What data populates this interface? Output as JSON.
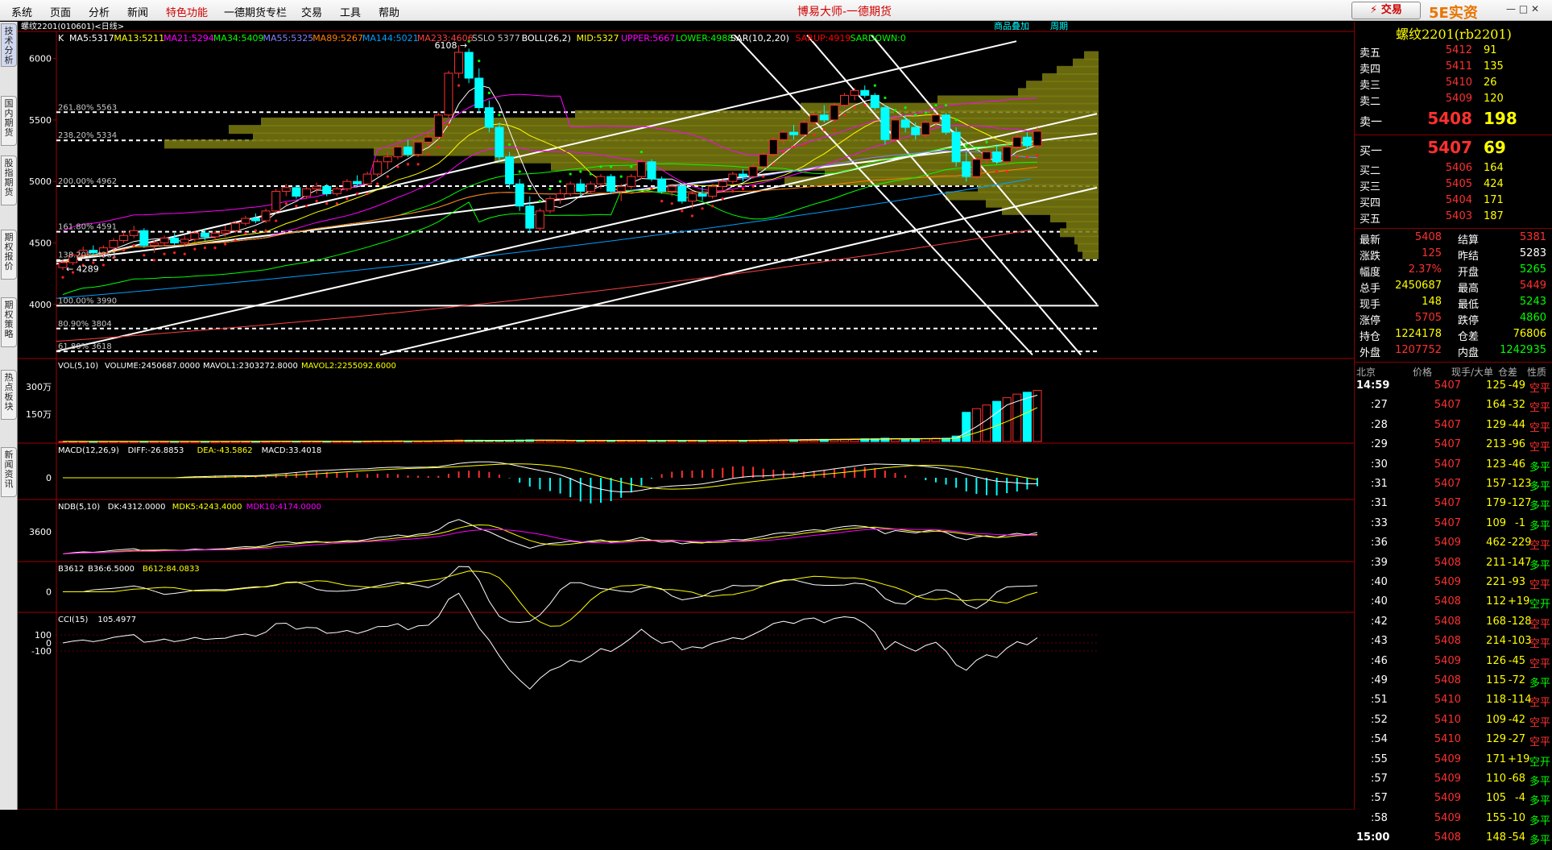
{
  "menu": [
    "系统",
    "页面",
    "分析",
    "新闻",
    "特色功能",
    "一德期货专栏",
    "交易",
    "工具",
    "帮助"
  ],
  "app_title": "博易大师-一德期货",
  "trade_button": "⚡ 交易",
  "watermark": "5E实资5etz.com",
  "window_controls": "— □ ✕",
  "side_tabs": [
    "技术分析",
    "国内期货",
    "股指期货",
    "期权报价",
    "期权策略",
    "热点板块",
    "新闻资讯"
  ],
  "chart": {
    "symbol_title": "螺纹2201(010601)<日线>",
    "top_buttons": [
      "商品叠加",
      "周期"
    ],
    "main_label": "K",
    "main_indicators": [
      {
        "text": "MA5:5317",
        "color": "#ffffff"
      },
      {
        "text": "MA13:5211",
        "color": "#ffff00"
      },
      {
        "text": "MA21:5294",
        "color": "#ff00ff"
      },
      {
        "text": "MA34:5409",
        "color": "#00ff00"
      },
      {
        "text": "MA55:5325",
        "color": "#8080ff"
      },
      {
        "text": "MA89:5267",
        "color": "#ff8000"
      },
      {
        "text": "MA144:5021",
        "color": "#00a0ff"
      },
      {
        "text": "MA233:4606",
        "color": "#ff4040"
      },
      {
        "text": "SSLO 5377",
        "color": "#c0c0c0"
      },
      {
        "text": "BOLL(26,2)",
        "color": "#ffffff"
      },
      {
        "text": "MID:5327",
        "color": "#ffff00"
      },
      {
        "text": "UPPER:5667",
        "color": "#ff00ff"
      },
      {
        "text": "LOWER:4988",
        "color": "#00ff00"
      },
      {
        "text": "SAR(10,2,20)",
        "color": "#ffffff"
      },
      {
        "text": "SARUP:4919",
        "color": "#ff0000"
      },
      {
        "text": "SARDOWN:0",
        "color": "#00ff00"
      }
    ],
    "price_ticks": [
      6000,
      5500,
      5000,
      4500,
      4000
    ],
    "fib_levels": [
      {
        "label": "261.80% 5563",
        "price": 5563
      },
      {
        "label": "238.20% 5334",
        "price": 5334
      },
      {
        "label": "200.00% 4962",
        "price": 4962
      },
      {
        "label": "161.80% 4591",
        "price": 4591
      },
      {
        "label": "138.20% 4361",
        "price": 4361
      },
      {
        "label": "100.00% 3990",
        "price": 3990
      },
      {
        "label": "80.90% 3804",
        "price": 3804
      },
      {
        "label": "61.80% 3618",
        "price": 3618
      }
    ],
    "annotations": {
      "high": "6108",
      "low": "4289"
    },
    "vol_label": "VOL(5,10)",
    "vol_indicators": [
      {
        "text": "VOLUME:2450687.0000",
        "color": "#ffffff"
      },
      {
        "text": "MAVOL1:2303272.8000",
        "color": "#ffffff"
      },
      {
        "text": "MAVOL2:2255092.6000",
        "color": "#ffff00"
      }
    ],
    "vol_ticks": [
      "300万",
      "150万"
    ],
    "macd_label": "MACD(12,26,9)",
    "macd_indicators": [
      {
        "text": "DIFF:-26.8853",
        "color": "#ffffff"
      },
      {
        "text": "DEA:-43.5862",
        "color": "#ffff00"
      },
      {
        "text": "MACD:33.4018",
        "color": "#ffffff"
      }
    ],
    "macd_ticks": [
      "0"
    ],
    "ndb_label": "NDB(5,10)",
    "ndb_indicators": [
      {
        "text": "DK:4312.0000",
        "color": "#ffffff"
      },
      {
        "text": "MDK5:4243.4000",
        "color": "#ffff00"
      },
      {
        "text": "MDK10:4174.0000",
        "color": "#ff00ff"
      }
    ],
    "ndb_ticks": [
      "3600"
    ],
    "b3612_label": "B3612",
    "b3612_indicators": [
      {
        "text": "B36:6.5000",
        "color": "#ffffff"
      },
      {
        "text": "B612:84.0833",
        "color": "#ffff00"
      }
    ],
    "b3612_ticks": [
      "0"
    ],
    "cci_label": "CCI(15)",
    "cci_indicators": [
      {
        "text": "105.4977",
        "color": "#ffffff"
      }
    ],
    "cci_ticks": [
      "100",
      "0",
      "-100"
    ]
  },
  "quote": {
    "title": "螺纹2201(rb2201)",
    "asks": [
      {
        "label": "卖五",
        "price": "5412",
        "vol": "91"
      },
      {
        "label": "卖四",
        "price": "5411",
        "vol": "135"
      },
      {
        "label": "卖三",
        "price": "5410",
        "vol": "26"
      },
      {
        "label": "卖二",
        "price": "5409",
        "vol": "120"
      },
      {
        "label": "卖一",
        "price": "5408",
        "vol": "198"
      }
    ],
    "bids": [
      {
        "label": "买一",
        "price": "5407",
        "vol": "69"
      },
      {
        "label": "买二",
        "price": "5406",
        "vol": "164"
      },
      {
        "label": "买三",
        "price": "5405",
        "vol": "424"
      },
      {
        "label": "买四",
        "price": "5404",
        "vol": "171"
      },
      {
        "label": "买五",
        "price": "5403",
        "vol": "187"
      }
    ],
    "stats": [
      {
        "l1": "最新",
        "v1": "5408",
        "c1": "red",
        "l2": "结算",
        "v2": "5381",
        "c2": "red"
      },
      {
        "l1": "涨跌",
        "v1": "125",
        "c1": "red",
        "l2": "昨结",
        "v2": "5283",
        "c2": "white"
      },
      {
        "l1": "幅度",
        "v1": "2.37%",
        "c1": "red",
        "l2": "开盘",
        "v2": "5265",
        "c2": "green"
      },
      {
        "l1": "总手",
        "v1": "2450687",
        "c1": "yellow",
        "l2": "最高",
        "v2": "5449",
        "c2": "red"
      },
      {
        "l1": "现手",
        "v1": "148",
        "c1": "yellow",
        "l2": "最低",
        "v2": "5243",
        "c2": "green"
      },
      {
        "l1": "涨停",
        "v1": "5705",
        "c1": "red",
        "l2": "跌停",
        "v2": "4860",
        "c2": "green"
      },
      {
        "l1": "持仓",
        "v1": "1224178",
        "c1": "yellow",
        "l2": "仓差",
        "v2": "76806",
        "c2": "yellow"
      },
      {
        "l1": "外盘",
        "v1": "1207752",
        "c1": "red",
        "l2": "内盘",
        "v2": "1242935",
        "c2": "green"
      }
    ],
    "ts_headers": [
      "北京",
      "价格",
      "现手/大单",
      "仓差",
      "性质"
    ],
    "ticks": [
      {
        "t": "14:59",
        "p": "5407",
        "v": "125",
        "c": "-49",
        "n": "空平",
        "nc": "red"
      },
      {
        "t": ":27",
        "p": "5407",
        "v": "164",
        "c": "-32",
        "n": "空平",
        "nc": "red"
      },
      {
        "t": ":28",
        "p": "5407",
        "v": "129",
        "c": "-44",
        "n": "空平",
        "nc": "red"
      },
      {
        "t": ":29",
        "p": "5407",
        "v": "213",
        "c": "-96",
        "n": "空平",
        "nc": "red"
      },
      {
        "t": ":30",
        "p": "5407",
        "v": "123",
        "c": "-46",
        "n": "多平",
        "nc": "green"
      },
      {
        "t": ":31",
        "p": "5407",
        "v": "157",
        "c": "-123",
        "n": "多平",
        "nc": "green"
      },
      {
        "t": ":31",
        "p": "5407",
        "v": "179",
        "c": "-127",
        "n": "多平",
        "nc": "green"
      },
      {
        "t": ":33",
        "p": "5407",
        "v": "109",
        "c": "-1",
        "n": "多平",
        "nc": "green"
      },
      {
        "t": ":36",
        "p": "5409",
        "v": "462",
        "c": "-229",
        "n": "空平",
        "nc": "red"
      },
      {
        "t": ":39",
        "p": "5408",
        "v": "211",
        "c": "-147",
        "n": "多平",
        "nc": "green"
      },
      {
        "t": ":40",
        "p": "5409",
        "v": "221",
        "c": "-93",
        "n": "空平",
        "nc": "red"
      },
      {
        "t": ":40",
        "p": "5408",
        "v": "112",
        "c": "+19",
        "n": "空开",
        "nc": "green"
      },
      {
        "t": ":42",
        "p": "5408",
        "v": "168",
        "c": "-128",
        "n": "空平",
        "nc": "red"
      },
      {
        "t": ":43",
        "p": "5408",
        "v": "214",
        "c": "-103",
        "n": "空平",
        "nc": "red"
      },
      {
        "t": ":46",
        "p": "5409",
        "v": "126",
        "c": "-45",
        "n": "空平",
        "nc": "red"
      },
      {
        "t": ":49",
        "p": "5408",
        "v": "115",
        "c": "-72",
        "n": "多平",
        "nc": "green"
      },
      {
        "t": ":51",
        "p": "5410",
        "v": "118",
        "c": "-114",
        "n": "空平",
        "nc": "red"
      },
      {
        "t": ":52",
        "p": "5410",
        "v": "109",
        "c": "-42",
        "n": "空平",
        "nc": "red"
      },
      {
        "t": ":54",
        "p": "5410",
        "v": "129",
        "c": "-27",
        "n": "空平",
        "nc": "red"
      },
      {
        "t": ":55",
        "p": "5409",
        "v": "171",
        "c": "+19",
        "n": "空开",
        "nc": "green"
      },
      {
        "t": ":57",
        "p": "5409",
        "v": "110",
        "c": "-68",
        "n": "多平",
        "nc": "green"
      },
      {
        "t": ":57",
        "p": "5409",
        "v": "105",
        "c": "-4",
        "n": "多平",
        "nc": "green"
      },
      {
        "t": ":58",
        "p": "5409",
        "v": "155",
        "c": "-10",
        "n": "多平",
        "nc": "green"
      },
      {
        "t": "15:00",
        "p": "5408",
        "v": "148",
        "c": "-54",
        "n": "多平",
        "nc": "green"
      }
    ]
  },
  "chart_data": {
    "type": "candlestick",
    "title": "螺纹2201(010601)<日线>",
    "ylim": [
      3560,
      6220
    ],
    "ohlc": [
      [
        4300,
        4360,
        4280,
        4340
      ],
      [
        4340,
        4420,
        4320,
        4400
      ],
      [
        4400,
        4470,
        4380,
        4440
      ],
      [
        4440,
        4480,
        4400,
        4420
      ],
      [
        4420,
        4480,
        4380,
        4460
      ],
      [
        4460,
        4540,
        4440,
        4520
      ],
      [
        4520,
        4600,
        4500,
        4560
      ],
      [
        4560,
        4640,
        4540,
        4600
      ],
      [
        4600,
        4620,
        4460,
        4480
      ],
      [
        4480,
        4520,
        4420,
        4500
      ],
      [
        4500,
        4560,
        4470,
        4540
      ],
      [
        4540,
        4580,
        4480,
        4500
      ],
      [
        4500,
        4560,
        4470,
        4530
      ],
      [
        4530,
        4600,
        4510,
        4580
      ],
      [
        4580,
        4620,
        4520,
        4550
      ],
      [
        4550,
        4600,
        4520,
        4580
      ],
      [
        4580,
        4640,
        4550,
        4600
      ],
      [
        4600,
        4680,
        4580,
        4660
      ],
      [
        4660,
        4720,
        4640,
        4700
      ],
      [
        4700,
        4740,
        4660,
        4680
      ],
      [
        4680,
        4780,
        4660,
        4760
      ],
      [
        4760,
        4940,
        4740,
        4920
      ],
      [
        4920,
        4980,
        4880,
        4950
      ],
      [
        4950,
        4970,
        4860,
        4880
      ],
      [
        4880,
        4960,
        4860,
        4940
      ],
      [
        4940,
        4990,
        4900,
        4960
      ],
      [
        4960,
        4980,
        4880,
        4900
      ],
      [
        4900,
        4960,
        4880,
        4940
      ],
      [
        4940,
        5020,
        4920,
        5000
      ],
      [
        5000,
        5050,
        4960,
        4980
      ],
      [
        4980,
        5080,
        4960,
        5060
      ],
      [
        5060,
        5180,
        5040,
        5160
      ],
      [
        5160,
        5240,
        5100,
        5200
      ],
      [
        5200,
        5300,
        5180,
        5280
      ],
      [
        5280,
        5340,
        5200,
        5220
      ],
      [
        5220,
        5340,
        5200,
        5320
      ],
      [
        5320,
        5400,
        5280,
        5360
      ],
      [
        5360,
        5560,
        5340,
        5540
      ],
      [
        5540,
        5900,
        5520,
        5880
      ],
      [
        5880,
        6108,
        5840,
        6050
      ],
      [
        6050,
        6080,
        5800,
        5840
      ],
      [
        5840,
        5920,
        5560,
        5600
      ],
      [
        5600,
        5660,
        5400,
        5440
      ],
      [
        5440,
        5480,
        5160,
        5200
      ],
      [
        5200,
        5240,
        4940,
        4980
      ],
      [
        4980,
        5020,
        4760,
        4800
      ],
      [
        4800,
        4880,
        4580,
        4620
      ],
      [
        4620,
        4780,
        4600,
        4760
      ],
      [
        4760,
        4880,
        4740,
        4860
      ],
      [
        4860,
        4940,
        4820,
        4900
      ],
      [
        4900,
        5000,
        4880,
        4980
      ],
      [
        4980,
        5020,
        4880,
        4920
      ],
      [
        4920,
        5000,
        4900,
        4980
      ],
      [
        4980,
        5060,
        4940,
        5040
      ],
      [
        5040,
        5060,
        4900,
        4920
      ],
      [
        4920,
        4980,
        4840,
        4960
      ],
      [
        4960,
        5060,
        4940,
        5040
      ],
      [
        5040,
        5180,
        5020,
        5160
      ],
      [
        5160,
        5180,
        5000,
        5020
      ],
      [
        5020,
        5040,
        4900,
        4920
      ],
      [
        4920,
        4980,
        4880,
        4960
      ],
      [
        4960,
        4980,
        4820,
        4840
      ],
      [
        4840,
        4920,
        4780,
        4900
      ],
      [
        4900,
        4960,
        4840,
        4880
      ],
      [
        4880,
        4980,
        4860,
        4960
      ],
      [
        4960,
        5020,
        4920,
        5000
      ],
      [
        5000,
        5080,
        4980,
        5060
      ],
      [
        5060,
        5100,
        5000,
        5040
      ],
      [
        5040,
        5140,
        5020,
        5120
      ],
      [
        5120,
        5240,
        5100,
        5220
      ],
      [
        5220,
        5360,
        5200,
        5340
      ],
      [
        5340,
        5420,
        5300,
        5400
      ],
      [
        5400,
        5460,
        5340,
        5380
      ],
      [
        5380,
        5500,
        5360,
        5480
      ],
      [
        5480,
        5560,
        5440,
        5540
      ],
      [
        5540,
        5620,
        5480,
        5500
      ],
      [
        5500,
        5640,
        5480,
        5620
      ],
      [
        5620,
        5720,
        5600,
        5700
      ],
      [
        5700,
        5760,
        5660,
        5740
      ],
      [
        5740,
        5780,
        5680,
        5700
      ],
      [
        5700,
        5720,
        5580,
        5600
      ],
      [
        5600,
        5620,
        5300,
        5340
      ],
      [
        5340,
        5520,
        5320,
        5500
      ],
      [
        5500,
        5540,
        5400,
        5440
      ],
      [
        5440,
        5480,
        5340,
        5380
      ],
      [
        5380,
        5500,
        5360,
        5480
      ],
      [
        5480,
        5560,
        5440,
        5540
      ],
      [
        5540,
        5560,
        5380,
        5400
      ],
      [
        5400,
        5440,
        5120,
        5160
      ],
      [
        5160,
        5240,
        5000,
        5040
      ],
      [
        5040,
        5200,
        5020,
        5180
      ],
      [
        5180,
        5260,
        5140,
        5240
      ],
      [
        5240,
        5300,
        5140,
        5160
      ],
      [
        5160,
        5300,
        5140,
        5280
      ],
      [
        5280,
        5380,
        5260,
        5360
      ],
      [
        5360,
        5400,
        5260,
        5290
      ],
      [
        5290,
        5440,
        5270,
        5408
      ]
    ],
    "volume_wan": [
      0.3,
      0.4,
      0.4,
      0.3,
      0.4,
      0.5,
      0.5,
      0.6,
      0.7,
      0.5,
      0.5,
      0.5,
      0.6,
      0.6,
      0.6,
      0.5,
      0.7,
      0.8,
      0.8,
      0.7,
      1,
      2,
      2,
      1.6,
      1.5,
      1.4,
      1.3,
      1.3,
      1.6,
      1.4,
      2,
      3,
      3,
      3,
      2,
      2,
      2.5,
      4,
      6,
      8,
      7,
      7,
      6,
      6,
      7,
      8,
      9,
      7,
      6,
      6,
      5,
      5,
      5,
      6,
      6,
      5,
      5,
      6,
      6,
      5,
      5,
      5,
      5,
      5,
      5,
      6,
      6,
      6,
      7,
      8,
      9,
      10,
      10,
      11,
      12,
      12,
      12,
      13,
      14,
      15,
      15,
      18,
      16,
      15,
      15,
      16,
      18,
      18,
      30,
      160,
      180,
      200,
      220,
      240,
      260,
      270,
      280,
      300,
      310,
      320,
      330
    ]
  }
}
